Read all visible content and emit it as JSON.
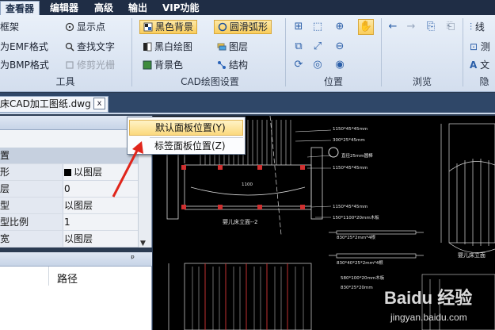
{
  "menubar": {
    "tabs": [
      "查看器",
      "编辑器",
      "高级",
      "输出",
      "VIP功能"
    ]
  },
  "ribbon": {
    "tools": {
      "items": [
        "框架",
        "为EMF格式",
        "为BMP格式",
        "显示点",
        "查找文字",
        "修剪光栅"
      ],
      "label": "工具"
    },
    "cad_settings": {
      "items": [
        "黑色背景",
        "圆滑弧形",
        "黑白绘图",
        "图层",
        "背景色",
        "结构"
      ],
      "label": "CAD绘图设置"
    },
    "position": {
      "label": "位置"
    },
    "browse": {
      "label": "浏览"
    },
    "hide": {
      "items": [
        "线",
        "测",
        "文"
      ],
      "label": "隐"
    }
  },
  "document": {
    "tab_title": "床CAD加工图纸.dwg",
    "close_glyph": "x"
  },
  "properties": {
    "section": "置",
    "rows": [
      {
        "key": "形",
        "value": "以图层"
      },
      {
        "key": "层",
        "value": "0"
      },
      {
        "key": "型",
        "value": "以图层"
      },
      {
        "key": "型比例",
        "value": "1"
      },
      {
        "key": "宽",
        "value": "以图层"
      }
    ],
    "pin_glyph": "ᵖ"
  },
  "path_panel": {
    "column": "路径",
    "pin_glyph": "ᵖ"
  },
  "context_menu": {
    "items": [
      "默认面板位置(Y)",
      "标签面板位置(Z)"
    ]
  },
  "drawing": {
    "labels": [
      "1150*45*45mm",
      "300*25*45mm",
      "直径25mm圆棒",
      "1150*45*45mm",
      "1150*45*45mm",
      "150*1100*20mm木板",
      "婴儿床立面--2",
      "830*25*2mm*4根",
      "830*40*25*2mm*4根",
      "580*100*20mm木板",
      "830*25*20mm",
      "婴儿床立面",
      "1100"
    ]
  },
  "watermark": {
    "text": "Baidu 经验",
    "url": "jingyan.baidu.com"
  }
}
